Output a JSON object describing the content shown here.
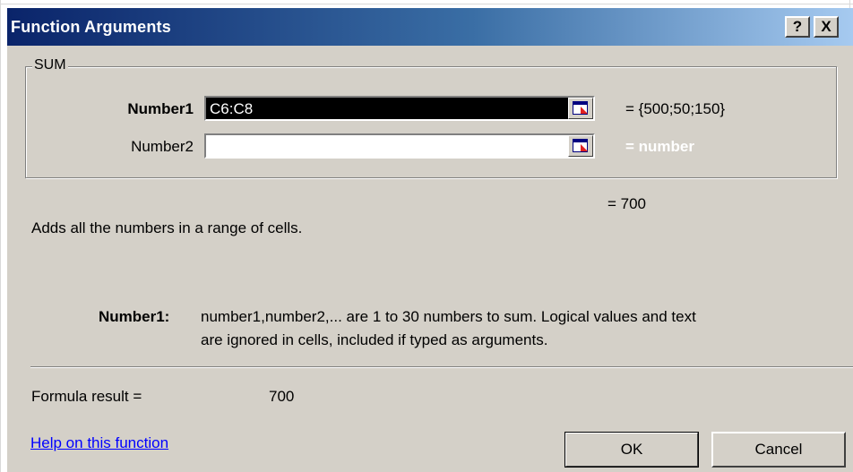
{
  "window": {
    "title": "Function Arguments",
    "help_button": "?",
    "close_button": "X"
  },
  "group": {
    "label": "SUM"
  },
  "arguments": [
    {
      "label": "Number1",
      "value": "C6:C8",
      "evaluated": "= {500;50;150}",
      "selected": true
    },
    {
      "label": "Number2",
      "value": "",
      "evaluated": "= number",
      "selected": false
    }
  ],
  "result_preview": "= 700",
  "description": "Adds all the numbers in a range of cells.",
  "arg_help": {
    "name": "Number1:",
    "line1": "number1,number2,... are 1 to 30 numbers to sum. Logical values and text",
    "line2": "are ignored in cells, included if typed as arguments."
  },
  "formula_result": {
    "label": "Formula result =",
    "value": "700"
  },
  "help_link": "Help on this function",
  "buttons": {
    "ok": "OK",
    "cancel": "Cancel"
  },
  "colors": {
    "dialog_bg": "#d4d0c8",
    "title_gradient_start": "#0a246a",
    "title_gradient_end": "#a6caf0",
    "link": "#0000ff"
  }
}
